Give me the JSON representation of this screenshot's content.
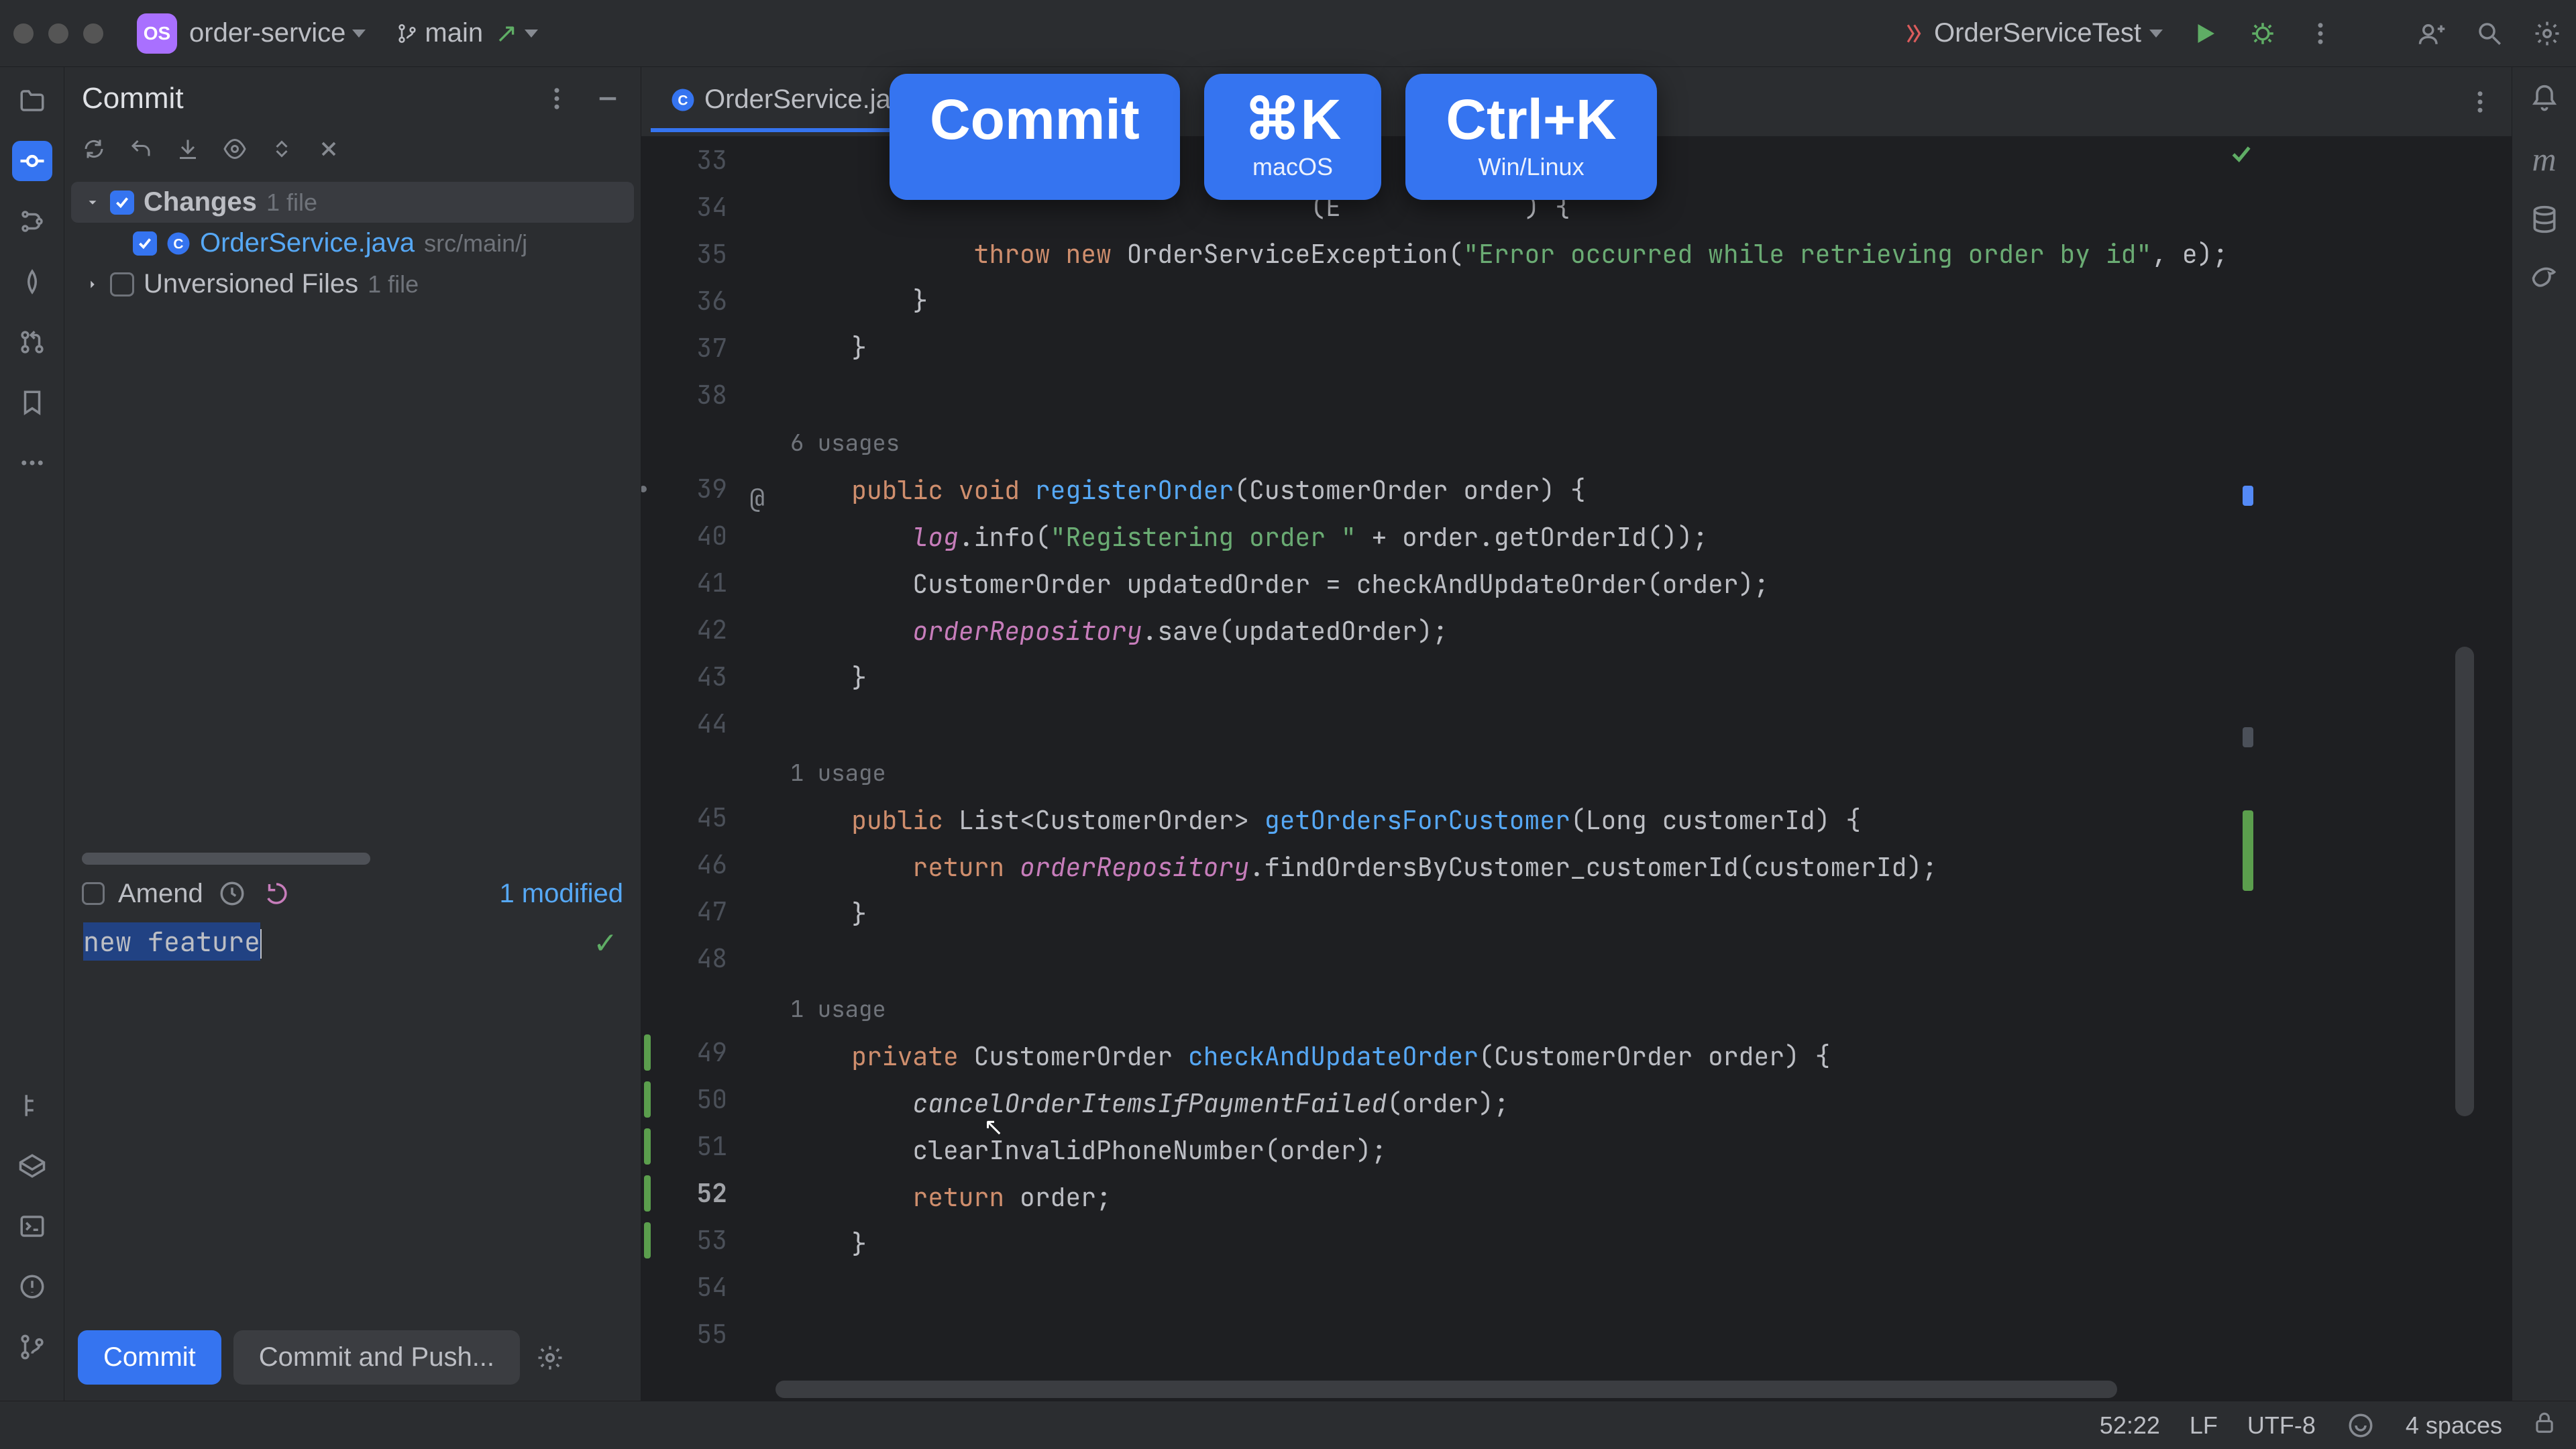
{
  "titlebar": {
    "project_badge": "OS",
    "project_name": "order-service",
    "branch_name": "main",
    "run_config": "OrderServiceTest"
  },
  "commit_panel": {
    "title": "Commit",
    "changes_label": "Changes",
    "changes_count": "1 file",
    "changed_file": "OrderService.java",
    "changed_file_path": "src/main/j",
    "unversioned_label": "Unversioned Files",
    "unversioned_count": "1 file",
    "amend_label": "Amend",
    "modified_link": "1 modified",
    "commit_message": "new feature",
    "commit_btn": "Commit",
    "commit_push_btn": "Commit and Push..."
  },
  "tabs": {
    "file_name": "OrderService.java"
  },
  "overlay": {
    "card1_big": "Commit",
    "card2_big": "⌘K",
    "card2_sub": "macOS",
    "card3_big": "Ctrl+K",
    "card3_sub": "Win/Linux"
  },
  "editor": {
    "usages6": "6 usages",
    "usages1a": "1 usage",
    "usages1b": "1 usage"
  },
  "statusbar": {
    "caret": "52:22",
    "line_sep": "LF",
    "encoding": "UTF-8",
    "indent": "4 spaces"
  }
}
